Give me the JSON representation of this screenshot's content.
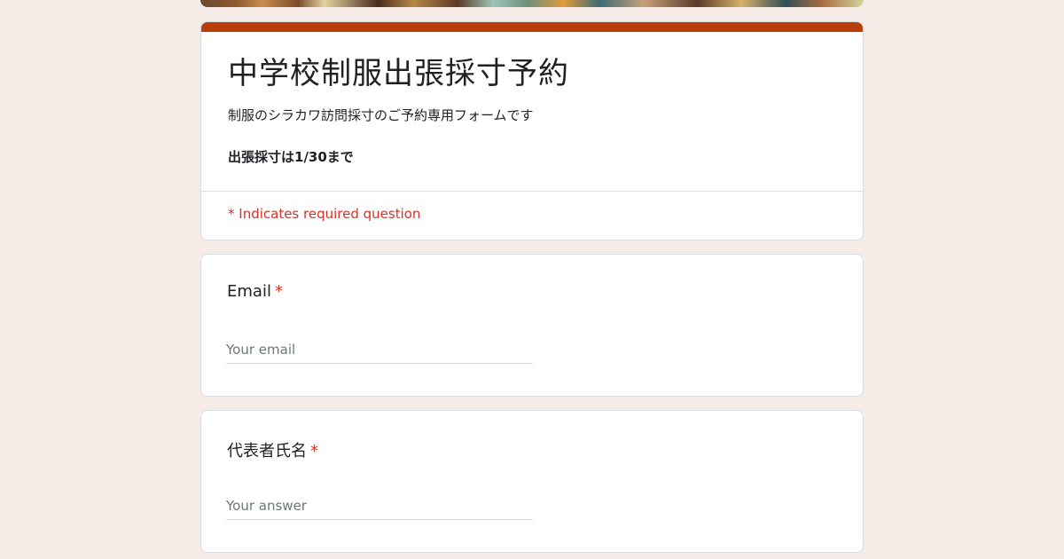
{
  "form": {
    "title": "中学校制服出張採寸予約",
    "description": "制服のシラカワ訪問採寸のご予約専用フォームです",
    "note": "出張採寸は1/30まで",
    "required_note": "* Indicates required question"
  },
  "questions": [
    {
      "label": "Email",
      "required_mark": "*",
      "placeholder": "Your email"
    },
    {
      "label": "代表者氏名",
      "required_mark": "*",
      "placeholder": "Your answer"
    }
  ],
  "colors": {
    "accent": "#b83d0b",
    "background": "#f6ebe6",
    "required": "#d93025"
  }
}
